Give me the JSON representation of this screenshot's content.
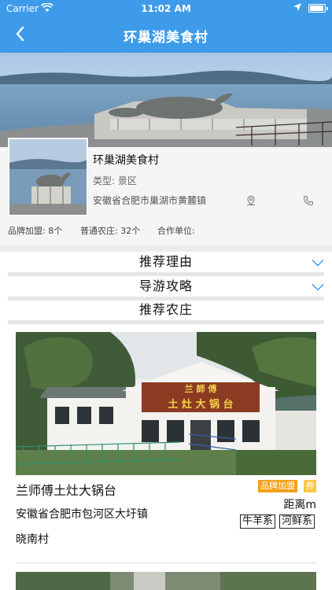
{
  "status": {
    "carrier": "Carrier",
    "time": "11:02 AM",
    "battery_level": 0.95
  },
  "nav": {
    "title": "环巢湖美食村"
  },
  "info": {
    "name": "环巢湖美食村",
    "type": "类型: 景区",
    "address": "安徽省合肥市巢湖市黄麓镇",
    "stats": {
      "brand": "品牌加盟: 8个",
      "farms": "普通农庄: 32个",
      "partners": "合作单位:"
    }
  },
  "sections": {
    "reason": "推荐理由",
    "guide": "导游攻略",
    "farms": "推荐农庄"
  },
  "farm": {
    "name": "兰师傅土灶大锅台",
    "tag_brand": "品牌加盟",
    "tag_coupon": "券",
    "distance": "距离m",
    "address_line1": "安徽省合肥市包河区大圩镇",
    "address_line2": "晓南村",
    "categories": [
      "牛羊系",
      "河鲜系"
    ],
    "sign_top": "兰 師 傅",
    "sign_bottom": "土 灶 大 锅 台"
  },
  "colors": {
    "primary": "#3d9be9",
    "tag_orange": "#f2a11b",
    "tag_yellow": "#f8c742"
  }
}
